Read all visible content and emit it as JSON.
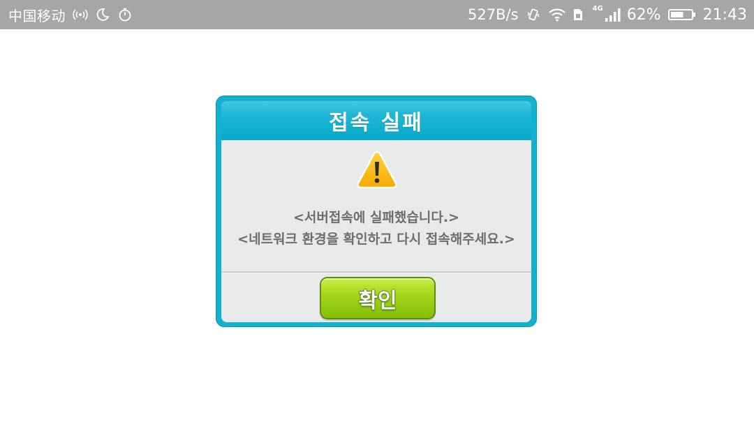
{
  "status_bar": {
    "carrier": "中国移动",
    "net_speed": "527B/s",
    "network_type": "4G",
    "battery": "62%",
    "battery_level": 0.62,
    "time": "21:43",
    "left_icons": [
      "nfc-signal-icon",
      "moon-icon",
      "timer-icon"
    ],
    "right_icons": [
      "vibrate-icon",
      "wifi-icon",
      "sim-icon",
      "cell-signal-icon",
      "battery-icon"
    ]
  },
  "dialog": {
    "title": "접속 실패",
    "icon": "warning-icon",
    "message_line1": "<서버접속에 실패했습니다.>",
    "message_line2": "<네트워크 환경을 확인하고 다시 접속해주세요.>",
    "ok_label": "확인"
  },
  "colors": {
    "status_bar_bg": "#a4a7a3",
    "dialog_border": "#14b0cf",
    "dialog_body": "#e7eae8",
    "ok_button": "#9fd214",
    "warning": "#f7b500"
  }
}
